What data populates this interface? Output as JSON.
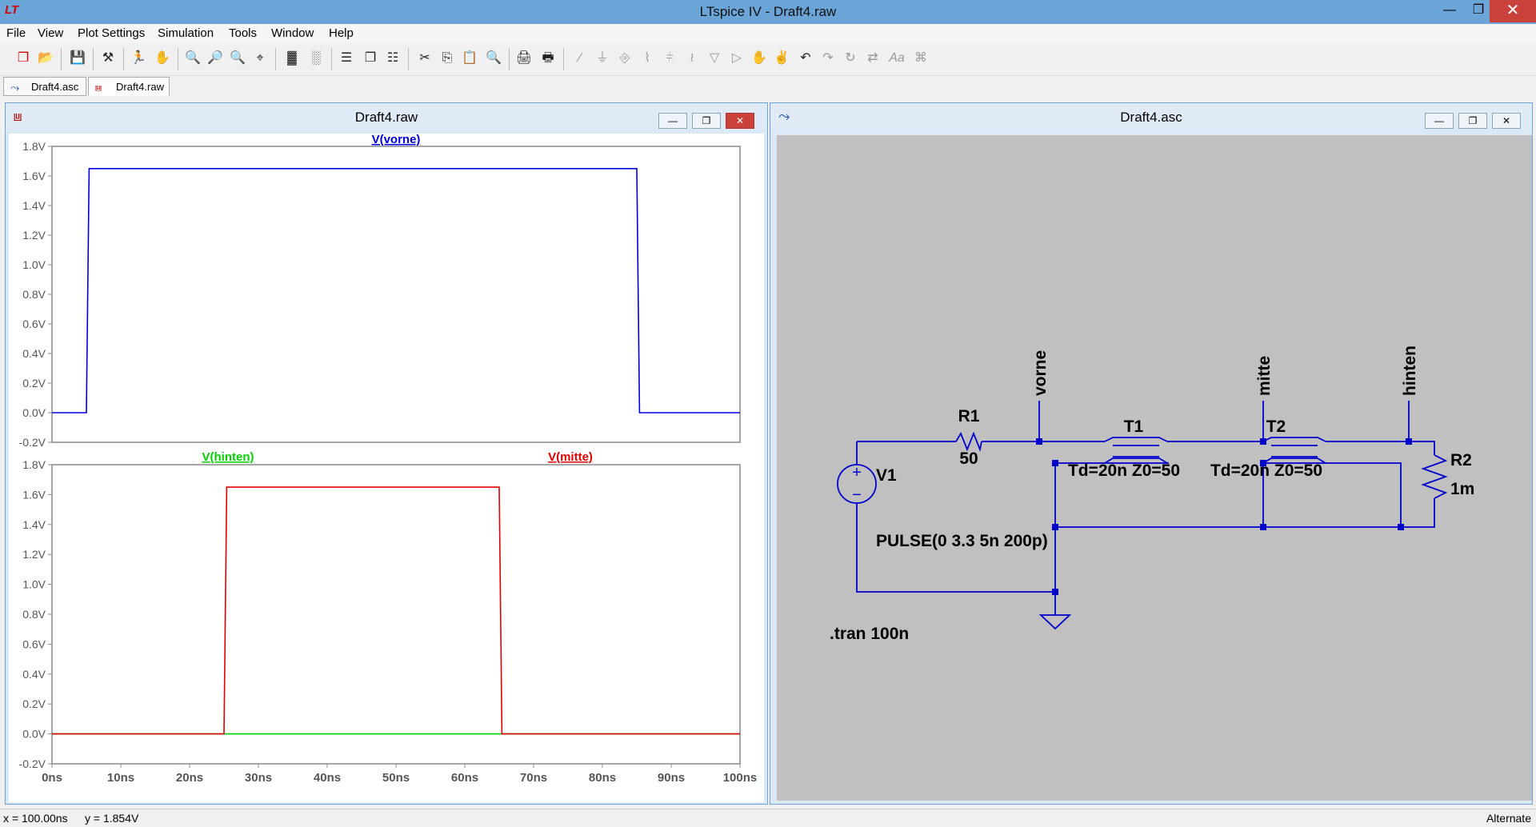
{
  "window": {
    "title": "LTspice IV - Draft4.raw",
    "app_icon": "ltspice-logo-icon"
  },
  "menu": [
    "File",
    "View",
    "Plot Settings",
    "Simulation",
    "Tools",
    "Window",
    "Help"
  ],
  "tabs": [
    {
      "label": "Draft4.asc",
      "icon": "schematic-icon"
    },
    {
      "label": "Draft4.raw",
      "icon": "waveform-icon",
      "active": true
    }
  ],
  "plot_window": {
    "title": "Draft4.raw",
    "panes": [
      {
        "traces": [
          {
            "name": "V(vorne)",
            "color": "#0000e0"
          }
        ],
        "yticks": [
          "1.8V",
          "1.6V",
          "1.4V",
          "1.2V",
          "1.0V",
          "0.8V",
          "0.6V",
          "0.4V",
          "0.2V",
          "0.0V",
          "-0.2V"
        ]
      },
      {
        "traces": [
          {
            "name": "V(hinten)",
            "color": "#00d000"
          },
          {
            "name": "V(mitte)",
            "color": "#e00000"
          }
        ],
        "yticks": [
          "1.8V",
          "1.6V",
          "1.4V",
          "1.2V",
          "1.0V",
          "0.8V",
          "0.6V",
          "0.4V",
          "0.2V",
          "0.0V",
          "-0.2V"
        ]
      }
    ],
    "xticks": [
      "0ns",
      "10ns",
      "20ns",
      "30ns",
      "40ns",
      "50ns",
      "60ns",
      "70ns",
      "80ns",
      "90ns",
      "100ns"
    ]
  },
  "chart_data": [
    {
      "type": "line",
      "xlim": [
        0,
        100
      ],
      "ylim": [
        -0.2,
        1.8
      ],
      "series": [
        {
          "name": "V(vorne)",
          "color": "#0000e0",
          "x": [
            0,
            5,
            5.4,
            85,
            85.4,
            100
          ],
          "y": [
            0,
            0,
            1.65,
            1.65,
            0,
            0
          ]
        }
      ]
    },
    {
      "type": "line",
      "xlim": [
        0,
        100
      ],
      "ylim": [
        -0.2,
        1.8
      ],
      "series": [
        {
          "name": "V(hinten)",
          "color": "#00d000",
          "x": [
            0,
            25,
            65,
            100
          ],
          "y": [
            0,
            0,
            0,
            0
          ]
        },
        {
          "name": "V(mitte)",
          "color": "#e00000",
          "x": [
            0,
            25,
            25.4,
            65,
            65.4,
            100
          ],
          "y": [
            0,
            0,
            1.65,
            1.65,
            0,
            0
          ]
        }
      ]
    }
  ],
  "schematic_window": {
    "title": "Draft4.asc",
    "components": {
      "r1_name": "R1",
      "r1_value": "50",
      "r2_name": "R2",
      "r2_value": "1m",
      "v1_name": "V1",
      "v1_value": "PULSE(0 3.3 5n 200p)",
      "t1_name": "T1",
      "t1_value": "Td=20n Z0=50",
      "t2_name": "T2",
      "t2_value": "Td=20n Z0=50"
    },
    "nets": {
      "vorne": "vorne",
      "mitte": "mitte",
      "hinten": "hinten"
    },
    "directive": ".tran 100n"
  },
  "status": {
    "cursor_x": "x = 100.00ns",
    "cursor_y": "y = 1.854V",
    "mode": "Alternate"
  }
}
